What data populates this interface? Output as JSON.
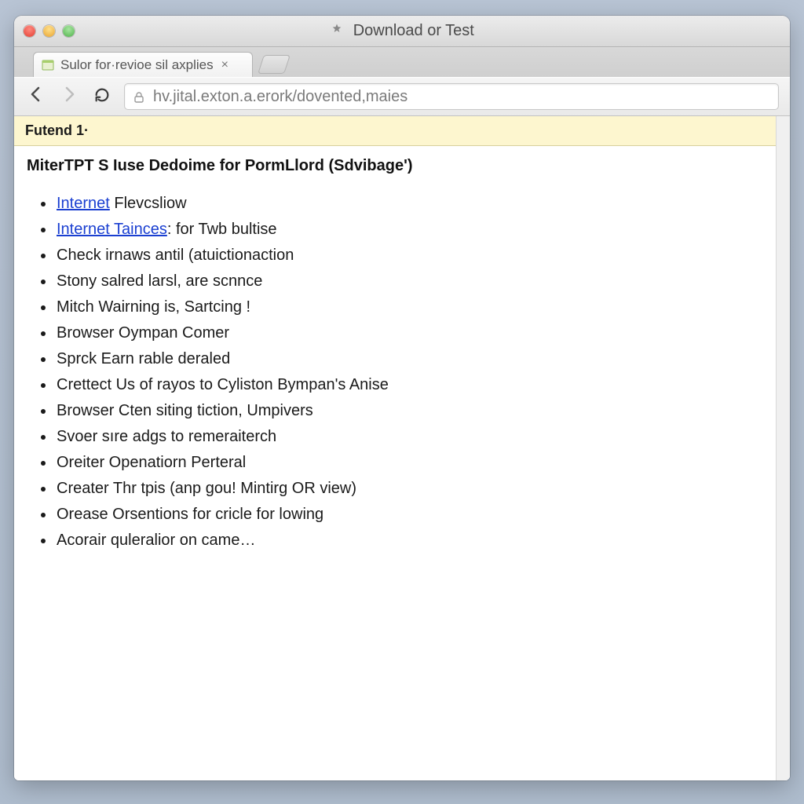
{
  "window": {
    "title": "Download or Test"
  },
  "tab": {
    "label": "Sulor for·revioe sil axplies"
  },
  "urlbar": {
    "url": "hv.jital.exton.a.erork/dovented,maies"
  },
  "banner": {
    "text": "Futend 1·"
  },
  "page": {
    "heading": "MiterTPT S Iuse Dedoime for PormLlord (Sdvibage')"
  },
  "items": [
    {
      "link": "Internet",
      "rest": " Flevcsliow"
    },
    {
      "link": "Internet Tainces",
      "rest": ": for Twb bultise"
    },
    {
      "text": "Check irnaws antil (atuictionaction"
    },
    {
      "text": "Stony salred larsl, are scnnce"
    },
    {
      "text": "Mitch Wairning is, Sartcing !"
    },
    {
      "text": "Browser Oympan Comer"
    },
    {
      "text": "Sprck Earn rable deraled"
    },
    {
      "text": "Crettect Us of rayos to Cyliston Bympan's Anise"
    },
    {
      "text": "Browser Cten siting tiction, Umpivers"
    },
    {
      "text": "Svoer sıre adgs to remeraiterch"
    },
    {
      "text": "Oreiter Openatiorn Perteral"
    },
    {
      "text": "Creater Thr tpis (anp gou! Mintirg OR view)"
    },
    {
      "text": "Orease Orsentions for cricle for lowing"
    },
    {
      "text": "Acorair quleralior on came…"
    }
  ]
}
